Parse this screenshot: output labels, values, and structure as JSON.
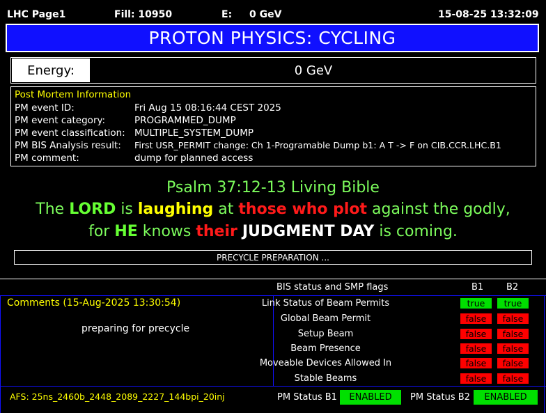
{
  "header": {
    "page": "LHC Page1",
    "fill": "Fill: 10950",
    "e_label": "E:",
    "e_value": "0 GeV",
    "datetime": "15-08-25 13:32:09"
  },
  "banner": {
    "title": "PROTON PHYSICS: CYCLING"
  },
  "energy": {
    "label": "Energy:",
    "value": "0 GeV"
  },
  "post_mortem": {
    "title": "Post Mortem Information",
    "rows": [
      {
        "label": "PM event ID:",
        "value": "Fri Aug 15 08:16:44 CEST 2025"
      },
      {
        "label": "PM event category:",
        "value": "PROGRAMMED_DUMP"
      },
      {
        "label": "PM event classification:",
        "value": "MULTIPLE_SYSTEM_DUMP"
      },
      {
        "label": "PM BIS Analysis result:",
        "value": "First USR_PERMIT change: Ch 1-Programable Dump b1: A T -> F on CIB.CCR.LHC.B1"
      },
      {
        "label": "PM comment:",
        "value": "dump for planned access"
      }
    ]
  },
  "verse": {
    "reference": "Psalm 37:12-13  Living Bible",
    "line1": {
      "p1": "The ",
      "p2": "LORD",
      "p3": " is ",
      "p4": "laughing",
      "p5": " at ",
      "p6": "those who plot",
      "p7": " against the godly,"
    },
    "line2": {
      "p1": "for ",
      "p2": "HE",
      "p3": " knows ",
      "p4": "their",
      "p5": " ",
      "p6": "JUDGMENT DAY",
      "p7": " is coming."
    }
  },
  "status_bar": {
    "text": "PRECYCLE PREPARATION ..."
  },
  "comments": {
    "title": "Comments (15-Aug-2025 13:30:54)",
    "text": "preparing for precycle"
  },
  "bis": {
    "title": "BIS status and SMP flags",
    "b1": "B1",
    "b2": "B2",
    "rows": [
      {
        "label": "Link Status of Beam Permits",
        "b1": "true",
        "b2": "true"
      },
      {
        "label": "Global Beam Permit",
        "b1": "false",
        "b2": "false"
      },
      {
        "label": "Setup Beam",
        "b1": "false",
        "b2": "false"
      },
      {
        "label": "Beam Presence",
        "b1": "false",
        "b2": "false"
      },
      {
        "label": "Moveable Devices Allowed In",
        "b1": "false",
        "b2": "false"
      },
      {
        "label": "Stable Beams",
        "b1": "false",
        "b2": "false"
      }
    ]
  },
  "footer": {
    "afs": "AFS: 25ns_2460b_2448_2089_2227_144bpi_20inj",
    "pm_b1_label": "PM Status B1",
    "pm_b1_value": "ENABLED",
    "pm_b2_label": "PM Status B2",
    "pm_b2_value": "ENABLED"
  }
}
